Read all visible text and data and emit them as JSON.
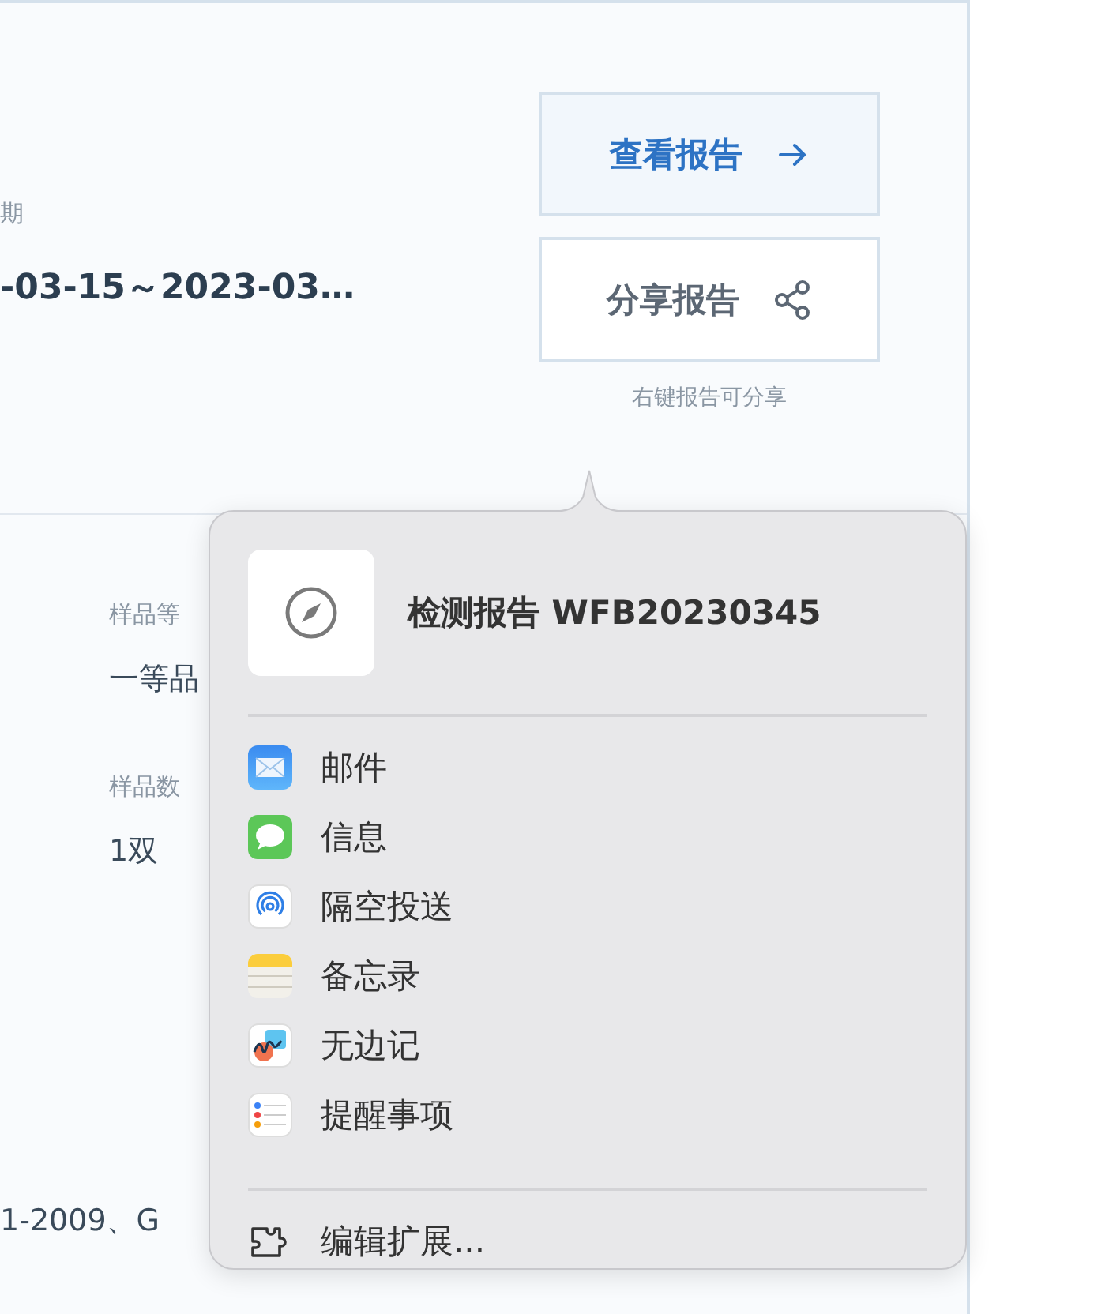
{
  "summary": {
    "date_label": "期",
    "date_value": "-03-15～2023-03…"
  },
  "actions": {
    "buttons": [
      {
        "label": "查看报告",
        "kind": "view"
      },
      {
        "label": "分享报告",
        "kind": "share"
      }
    ],
    "hint": "右键报告可分享"
  },
  "details": {
    "fields": [
      {
        "label": "样品等",
        "value": "一等品"
      },
      {
        "label": "样品数",
        "value": "1双"
      }
    ],
    "standard_value": "1-2009、G"
  },
  "share_popover": {
    "title": "检测报告 WFB20230345",
    "apps": [
      {
        "label": "邮件",
        "kind": "mail"
      },
      {
        "label": "信息",
        "kind": "messages"
      },
      {
        "label": "隔空投送",
        "kind": "airdrop"
      },
      {
        "label": "备忘录",
        "kind": "notes"
      },
      {
        "label": "无边记",
        "kind": "freeform"
      },
      {
        "label": "提醒事项",
        "kind": "reminders"
      }
    ],
    "footer": "编辑扩展..."
  }
}
